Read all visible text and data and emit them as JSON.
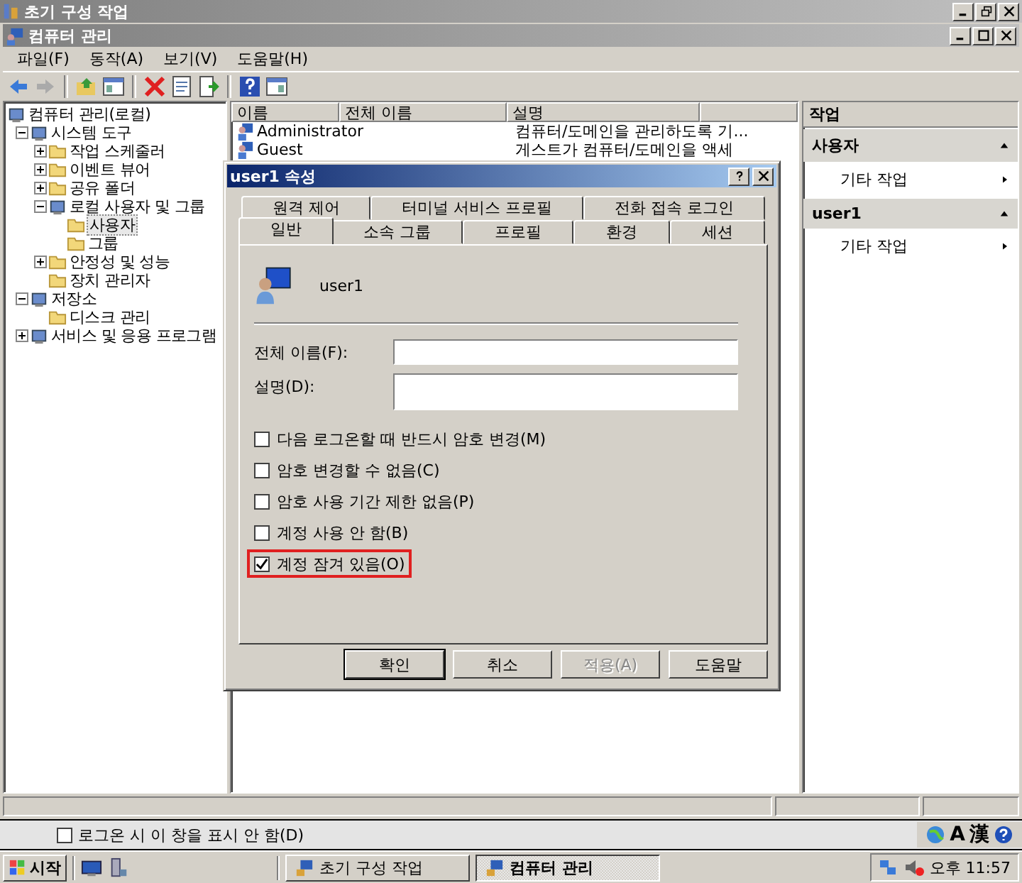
{
  "outer_window": {
    "title": "초기 구성 작업"
  },
  "window": {
    "title": "컴퓨터 관리"
  },
  "menu": [
    "파일(F)",
    "동작(A)",
    "보기(V)",
    "도움말(H)"
  ],
  "tree": [
    {
      "label": "컴퓨터 관리(로컬)",
      "selected": false,
      "children": [
        {
          "label": "시스템 도구",
          "expanded": true,
          "selected": false,
          "children": [
            {
              "label": "작업 스케줄러",
              "expanded": false,
              "selected": false
            },
            {
              "label": "이벤트 뷰어",
              "expanded": false,
              "selected": false
            },
            {
              "label": "공유 폴더",
              "expanded": false,
              "selected": false
            },
            {
              "label": "로컬 사용자 및 그룹",
              "expanded": true,
              "selected": false,
              "children": [
                {
                  "label": "사용자",
                  "selected": true
                },
                {
                  "label": "그룹",
                  "selected": false
                }
              ]
            },
            {
              "label": "안정성 및 성능",
              "expanded": false,
              "selected": false
            },
            {
              "label": "장치 관리자",
              "selected": false
            }
          ]
        },
        {
          "label": "저장소",
          "expanded": true,
          "selected": false,
          "children": [
            {
              "label": "디스크 관리",
              "selected": false
            }
          ]
        },
        {
          "label": "서비스 및 응용 프로그램",
          "expanded": false,
          "selected": false
        }
      ]
    }
  ],
  "list": {
    "columns": [
      "이름",
      "전체 이름",
      "설명"
    ],
    "rows": [
      {
        "name": "Administrator",
        "description": "컴퓨터/도메인을 관리하도록 기..."
      },
      {
        "name": "Guest",
        "description": "게스트가 컴퓨터/도메인을 액세"
      }
    ]
  },
  "actions": {
    "title": "작업",
    "sections": [
      {
        "title": "사용자",
        "items": [
          "기타 작업"
        ]
      },
      {
        "title": "user1",
        "items": [
          "기타 작업"
        ]
      }
    ]
  },
  "dialog": {
    "title": "user1 속성",
    "tab_rows": [
      [
        {
          "label": "원격 제어",
          "selected": false
        },
        {
          "label": "터미널 서비스 프로필",
          "selected": false
        },
        {
          "label": "전화 접속 로그인",
          "selected": false
        }
      ],
      [
        {
          "label": "일반",
          "selected": true
        },
        {
          "label": "소속 그룹",
          "selected": false
        },
        {
          "label": "프로필",
          "selected": false
        },
        {
          "label": "환경",
          "selected": false
        },
        {
          "label": "세션",
          "selected": false
        }
      ]
    ],
    "user": "user1",
    "fields": [
      {
        "label": "전체 이름(F):",
        "kind": "line"
      },
      {
        "label": "설명(D):",
        "kind": "box"
      }
    ],
    "checkboxes": [
      {
        "label": "다음 로그온할 때 반드시 암호 변경(M)",
        "checked": false,
        "highlighted": false
      },
      {
        "label": "암호 변경할 수 없음(C)",
        "checked": false,
        "highlighted": false
      },
      {
        "label": "암호 사용 기간 제한 없음(P)",
        "checked": false,
        "highlighted": false
      },
      {
        "label": "계정 사용 안 함(B)",
        "checked": false,
        "highlighted": false
      },
      {
        "label": "계정 잠겨 있음(O)",
        "checked": true,
        "highlighted": true
      }
    ],
    "buttons": [
      {
        "label": "확인",
        "default": true,
        "disabled": false
      },
      {
        "label": "취소",
        "default": false,
        "disabled": false
      },
      {
        "label": "적용(A)",
        "default": false,
        "disabled": true
      },
      {
        "label": "도움말",
        "default": false,
        "disabled": false
      }
    ]
  },
  "startup_option": {
    "label": "로그온 시 이 창을 표시 안 함(D)",
    "checked": false
  },
  "taskbar": {
    "start": "시작",
    "tasks": [
      {
        "label": "초기 구성 작업",
        "selected": false
      },
      {
        "label": "컴퓨터 관리",
        "selected": true
      }
    ],
    "clock": "오후 11:57"
  },
  "language_bar": [
    "A",
    "漢"
  ]
}
